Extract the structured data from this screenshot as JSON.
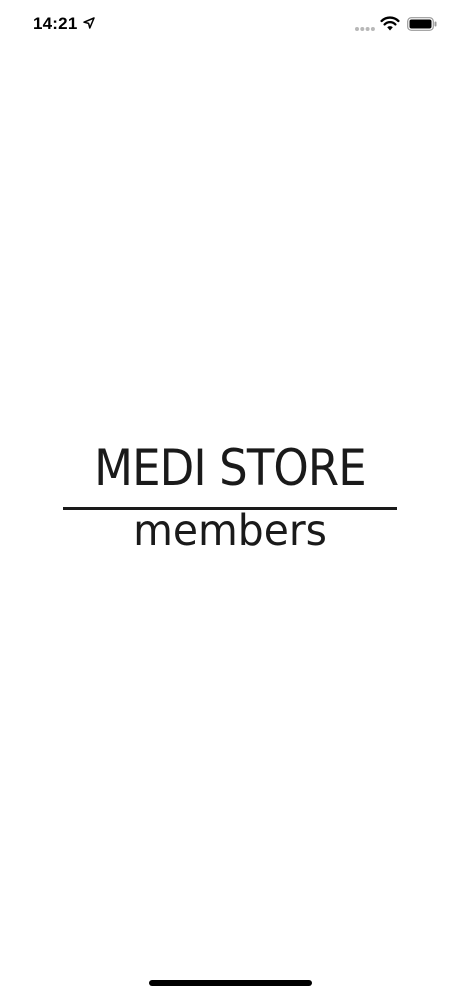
{
  "status_bar": {
    "time": "14:21",
    "location_icon": "location-arrow-icon",
    "signal_icon": "cellular-signal-icon",
    "wifi_icon": "wifi-icon",
    "battery_icon": "battery-icon"
  },
  "logo": {
    "top_text": "MEDI STORE",
    "bottom_text": "members"
  },
  "colors": {
    "background": "#ffffff",
    "text": "#1a1a1a",
    "indicator": "#000000"
  }
}
